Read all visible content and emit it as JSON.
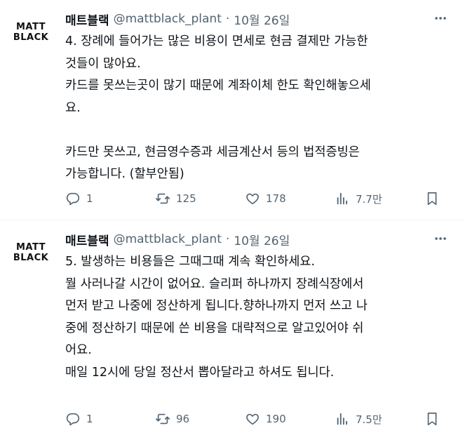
{
  "tweets": [
    {
      "avatar": {
        "line1": "MATT",
        "line2": "BLACK"
      },
      "name": "매트블랙",
      "handle": "@mattblack_plant",
      "separator": "·",
      "date": "10월 26일",
      "lines": [
        "4. 장례에 들어가는 많은 비용이 면세로 현금 결제만 가능한",
        "것들이 많아요.",
        "카드를 못쓰는곳이 많기 때문에 계좌이체 한도 확인해놓으세",
        "요.",
        "",
        "카드만 못쓰고, 현금영수증과 세금계산서 등의 법적증빙은",
        "가능합니다. (할부안됨)"
      ],
      "replies": "1",
      "retweets": "125",
      "likes": "178",
      "views": "7.7만"
    },
    {
      "avatar": {
        "line1": "MATT",
        "line2": "BLACK"
      },
      "name": "매트블랙",
      "handle": "@mattblack_plant",
      "separator": "·",
      "date": "10월 26일",
      "lines": [
        "5. 발생하는 비용들은 그때그때 계속 확인하세요.",
        "뭘 사러나갈 시간이 없어요. 슬리퍼 하나까지 장례식장에서",
        "먼저 받고 나중에 정산하게 됩니다.향하나까지 먼저 쓰고 나",
        "중에 정산하기 때문에 쓴 비용을 대략적으로 알고있어야 쉬",
        "어요.",
        "매일 12시에 당일 정산서 뽑아달라고 하셔도 됩니다."
      ],
      "replies": "1",
      "retweets": "96",
      "likes": "190",
      "views": "7.5만"
    }
  ],
  "icons": [
    "more-icon",
    "reply-icon",
    "retweet-icon",
    "like-icon",
    "views-icon",
    "bookmark-icon"
  ],
  "colors": {
    "text": "#0f1419",
    "secondary": "#536471",
    "divider": "#eff3f4"
  }
}
